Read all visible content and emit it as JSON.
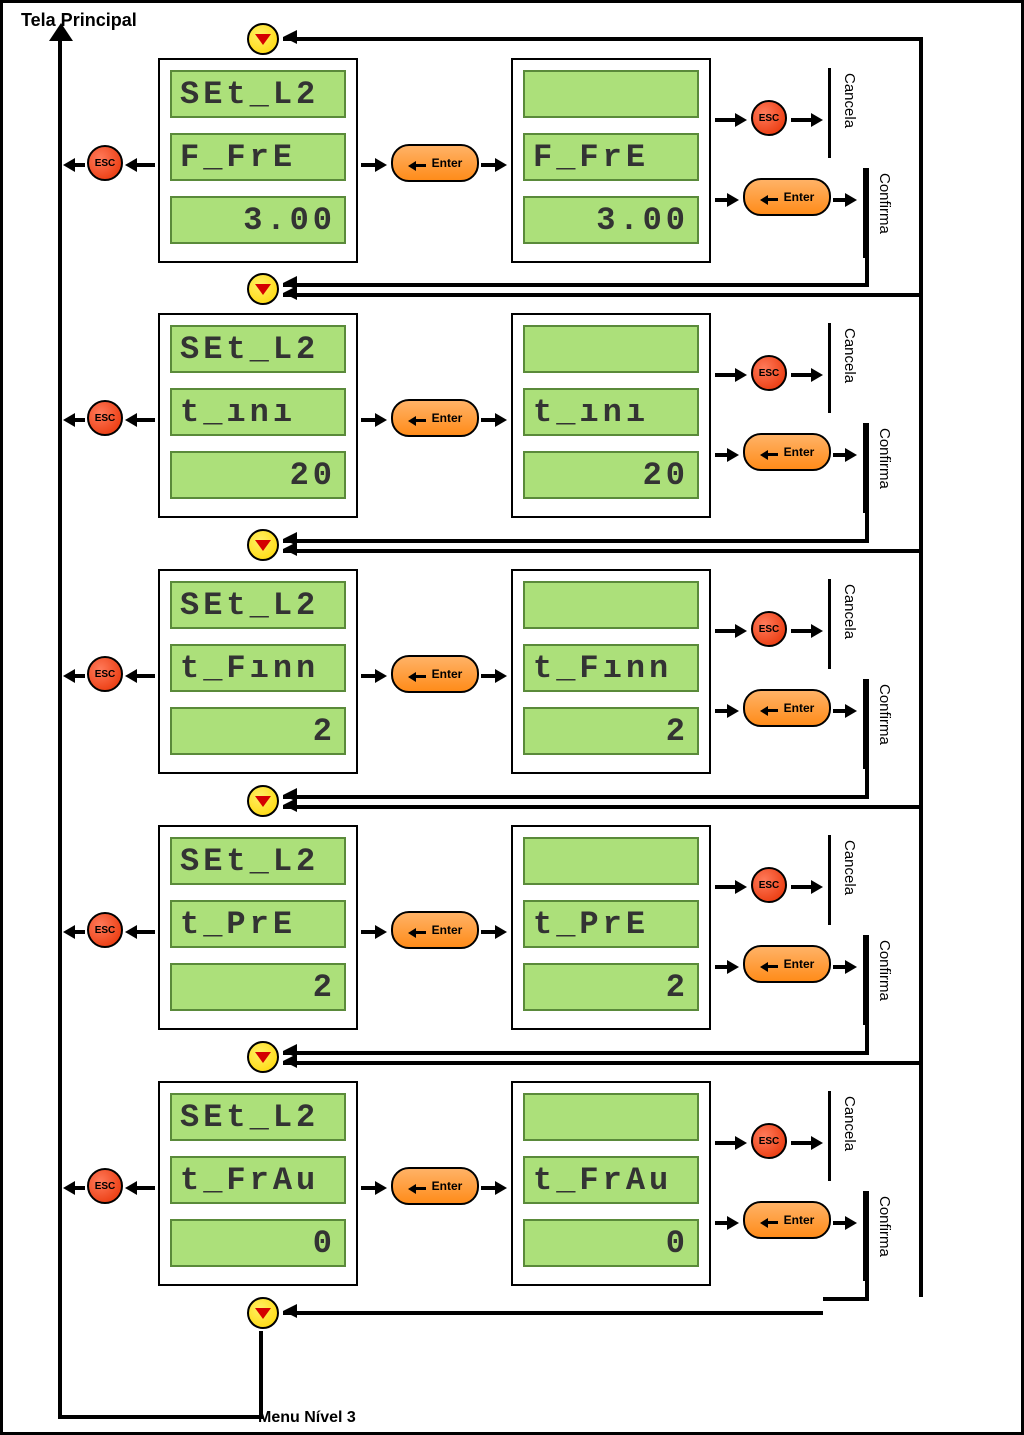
{
  "labels": {
    "tela_principal": "Tela Principal",
    "menu_nivel": "Menu Nível 3",
    "esc": "ESC",
    "enter": "Enter",
    "cancela": "Cancela",
    "confirma": "Confirma"
  },
  "rows": [
    {
      "left": {
        "line1": "SEt_L2",
        "line2": "F_FrE",
        "line3": "3.00"
      },
      "right": {
        "line1": "",
        "line2": "F_FrE",
        "line3": "3.00"
      }
    },
    {
      "left": {
        "line1": "SEt_L2",
        "line2": "t_ını",
        "line3": "20"
      },
      "right": {
        "line1": "",
        "line2": "t_ını",
        "line3": "20"
      }
    },
    {
      "left": {
        "line1": "SEt_L2",
        "line2": "t_Fınn",
        "line3": "2"
      },
      "right": {
        "line1": "",
        "line2": "t_Fınn",
        "line3": "2"
      }
    },
    {
      "left": {
        "line1": "SEt_L2",
        "line2": "t_PrE",
        "line3": "2"
      },
      "right": {
        "line1": "",
        "line2": "t_PrE",
        "line3": "2"
      }
    },
    {
      "left": {
        "line1": "SEt_L2",
        "line2": "t_FrAu",
        "line3": "0"
      },
      "right": {
        "line1": "",
        "line2": "t_FrAu",
        "line3": "0"
      }
    }
  ]
}
